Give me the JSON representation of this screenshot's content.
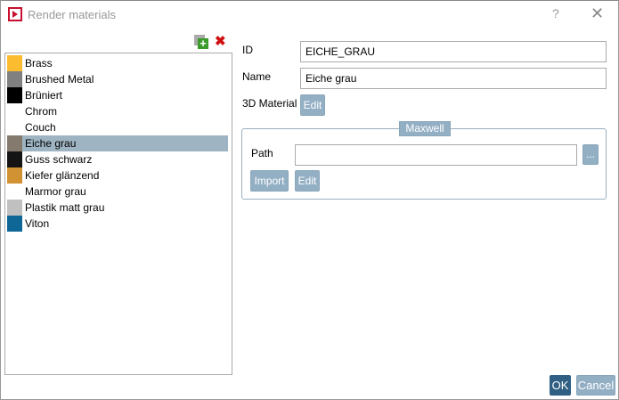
{
  "window": {
    "title": "Render materials",
    "help": "?",
    "close": "✕"
  },
  "toolbar": {
    "add_icon": "add-icon",
    "delete_icon": "delete-icon",
    "delete_glyph": "✖"
  },
  "materials": [
    {
      "label": "Brass",
      "color": "#fbbd2f"
    },
    {
      "label": "Brushed Metal",
      "color": "#808080"
    },
    {
      "label": "Brüniert",
      "color": "#000000"
    },
    {
      "label": "Chrom",
      "color": "#ffffff"
    },
    {
      "label": "Couch",
      "color": "#ffffff"
    },
    {
      "label": "Eiche grau",
      "color": "#857a6e",
      "selected": true
    },
    {
      "label": "Guss schwarz",
      "color": "#141414"
    },
    {
      "label": "Kiefer glänzend",
      "color": "#d09232"
    },
    {
      "label": "Marmor grau",
      "color": "#ffffff"
    },
    {
      "label": "Plastik matt grau",
      "color": "#c0c0c0"
    },
    {
      "label": "Viton",
      "color": "#0e6796"
    }
  ],
  "form": {
    "id_label": "ID",
    "id_value": "EICHE_GRAU",
    "name_label": "Name",
    "name_value": "Eiche grau",
    "material_label": "3D Material",
    "edit": "Edit"
  },
  "maxwell": {
    "legend": "Maxwell",
    "path_label": "Path",
    "path_value": "",
    "browse": "...",
    "import": "Import",
    "edit": "Edit"
  },
  "footer": {
    "ok": "OK",
    "cancel": "Cancel"
  }
}
